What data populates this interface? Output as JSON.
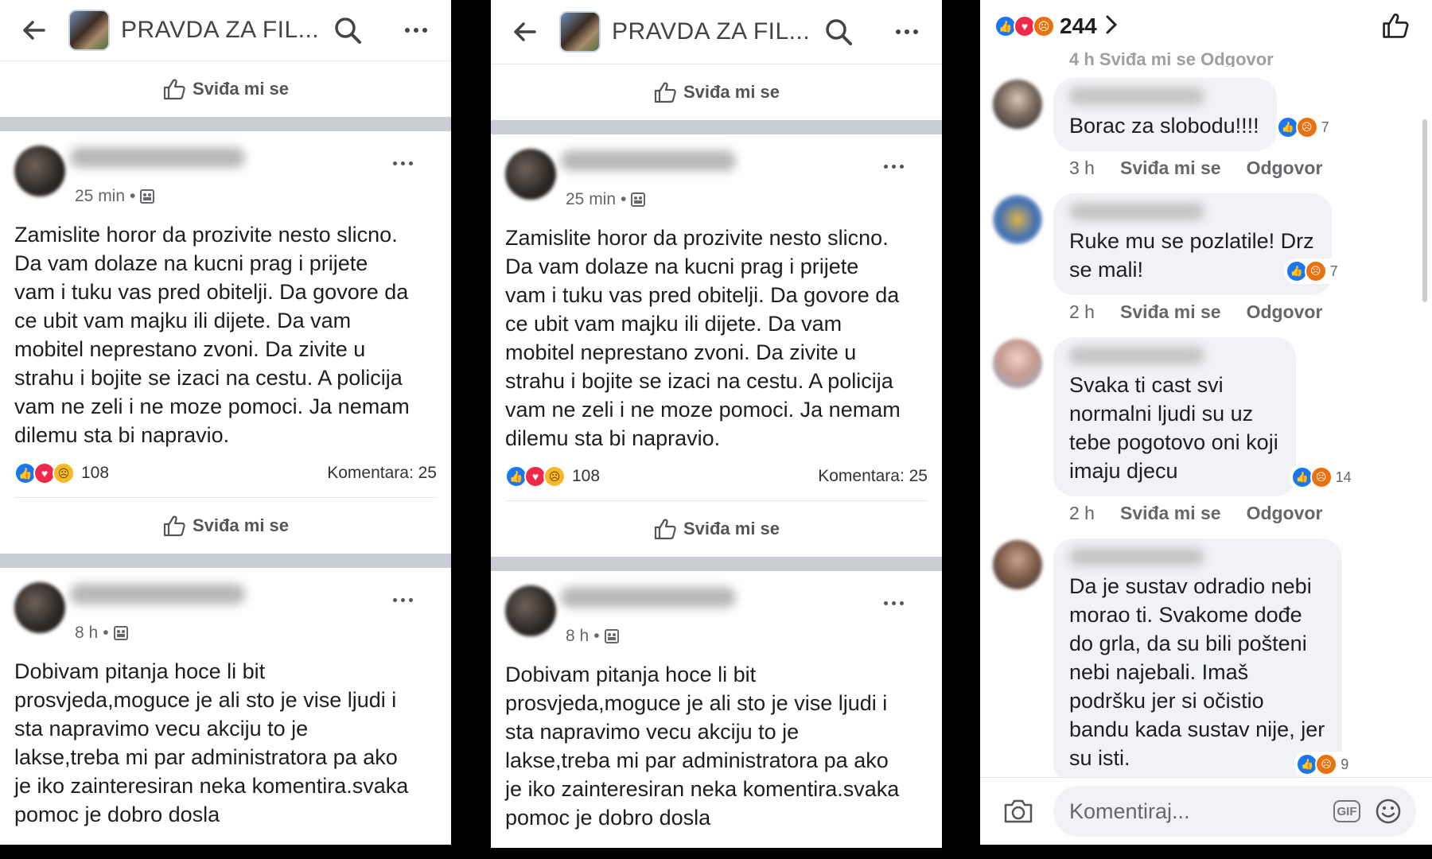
{
  "header": {
    "title": "PRAVDA ZA FIL..."
  },
  "like_label": "Sviđa mi se",
  "post1": {
    "time": "25 min",
    "text": "Zamislite horor da prozivite nesto slicno.\nDa vam dolaze na kucni prag i prijete\nvam i tuku vas pred obitelji. Da govore da\nce ubit vam majku ili dijete. Da vam\nmobitel neprestano zvoni. Da zivite u\nstrahu i bojite se izaci na cestu. A policija\nvam ne zeli i ne moze pomoci. Ja nemam\ndilemu sta bi napravio.",
    "reaction_count": "108",
    "comments": "Komentara: 25"
  },
  "post2": {
    "time": "8 h",
    "text": "Dobivam pitanja hoce li bit\nprosvjeda,moguce je ali sto je vise ljudi i\nsta napravimo vecu akciju to je\nlakse,treba mi par administratora pa ako\nje iko zainteresiran neka komentira.svaka\npomoc je dobro dosla"
  },
  "comments_panel": {
    "reaction_total": "244",
    "ghost_row": "4 h    Sviđa mi se    Odgovor",
    "reply_label": "Odgovor",
    "input_placeholder": "Komentiraj...",
    "gif_label": "GIF",
    "comments": [
      {
        "text": "Borac za slobodu!!!!",
        "reactions": "7",
        "time": "3 h"
      },
      {
        "text": "Ruke mu se pozlatile! Drz\nse mali!",
        "reactions": "7",
        "time": "2 h"
      },
      {
        "text": "Svaka  ti  cast    svi\nnormalni  ljudi  su  uz\ntebe  pogotovo  oni  koji\nimaju  djecu",
        "reactions": "14",
        "time": "2 h"
      },
      {
        "text": "Da je sustav odradio nebi\nmorao ti. Svakome dođe\ndo grla, da su bili pošteni\nnebi najebali. Imaš\npodršku jer si očistio\nbandu kada sustav nije, jer\nsu isti.",
        "reactions": "9"
      }
    ]
  },
  "colors": {
    "like_blue": "#1877f2",
    "love_red": "#f02849",
    "angry_orange": "#e9710f",
    "bubble": "#f0f2f5"
  }
}
